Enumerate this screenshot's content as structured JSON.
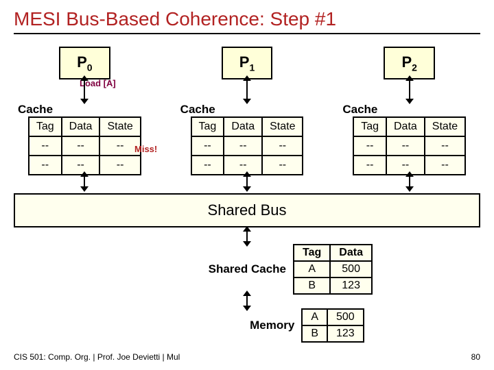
{
  "title": "MESI Bus-Based Coherence: Step #1",
  "processors": [
    {
      "name": "P",
      "sub": "0"
    },
    {
      "name": "P",
      "sub": "1"
    },
    {
      "name": "P",
      "sub": "2"
    }
  ],
  "load_label": "Load [A]",
  "miss_label": "Miss!",
  "cache_heading": "Cache",
  "cache_cols": [
    "Tag",
    "Data",
    "State"
  ],
  "caches": [
    {
      "rows": [
        [
          "--",
          "--",
          "--"
        ],
        [
          "--",
          "--",
          "--"
        ]
      ]
    },
    {
      "rows": [
        [
          "--",
          "--",
          "--"
        ],
        [
          "--",
          "--",
          "--"
        ]
      ]
    },
    {
      "rows": [
        [
          "--",
          "--",
          "--"
        ],
        [
          "--",
          "--",
          "--"
        ]
      ]
    }
  ],
  "bus_label": "Shared Bus",
  "shared_cache": {
    "label": "Shared Cache",
    "cols": [
      "Tag",
      "Data"
    ],
    "rows": [
      [
        "A",
        "500"
      ],
      [
        "B",
        "123"
      ]
    ]
  },
  "memory": {
    "label": "Memory",
    "rows": [
      [
        "A",
        "500"
      ],
      [
        "B",
        "123"
      ]
    ]
  },
  "footer_left": "CIS 501: Comp. Org. | Prof. Joe Devietti | Mul",
  "footer_right": "80"
}
